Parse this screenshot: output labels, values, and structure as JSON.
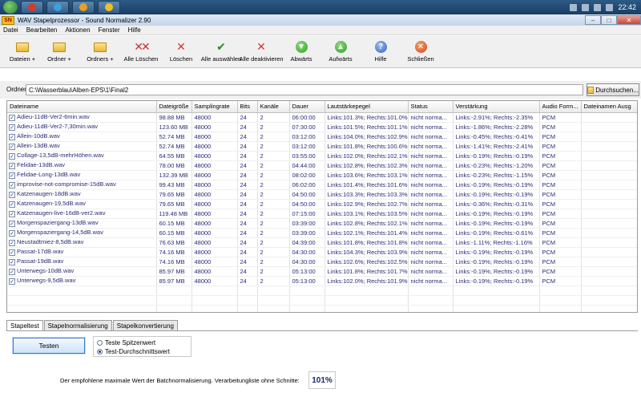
{
  "taskbar": {
    "clock": "22:42"
  },
  "window": {
    "title": "WAV Stapelprozessor - Sound Normalizer 2.90",
    "app_icon_text": "SN"
  },
  "menu": [
    "Datei",
    "Bearbeiten",
    "Aktionen",
    "Fenster",
    "Hilfe"
  ],
  "toolbar": [
    {
      "label": "Dateien +",
      "icon": "folder-icon"
    },
    {
      "label": "Ordner +",
      "icon": "folder-icon"
    },
    {
      "label": "Ordners +",
      "icon": "folder-icon"
    },
    {
      "label": "Alle Löschen",
      "icon": "double-x-icon"
    },
    {
      "label": "Löschen",
      "icon": "x-icon"
    },
    {
      "label": "Alle auswählen",
      "icon": "check-icon"
    },
    {
      "label": "Alle deaktivieren",
      "icon": "x-icon"
    },
    {
      "label": "Abwärts",
      "icon": "arrow-down-icon"
    },
    {
      "label": "Aufwärts",
      "icon": "arrow-up-icon"
    },
    {
      "label": "Hilfe",
      "icon": "help-icon"
    },
    {
      "label": "Schließen",
      "icon": "close-icon"
    }
  ],
  "folder": {
    "label": "Ordner",
    "value": "C:\\Wasserblau\\Alben-EPS\\1\\Final2",
    "browse_label": "Durchsuchen..."
  },
  "grid": {
    "columns": [
      "Dateiname",
      "Dateigröße",
      "Samplingrate",
      "Bits",
      "Kanäle",
      "Dauer",
      "Lautstärkepegel",
      "Status",
      "Verstärkung",
      "Audio Form...",
      "Dateinamen Ausg"
    ],
    "rows": [
      [
        "Adieu-11dB-Ver2-6min.wav",
        "98.88 MB",
        "48000",
        "24",
        "2",
        "06:00:00",
        "Links:101.3%; Rechts:101.0%",
        "nicht norma...",
        "Links:-2.91%; Rechts:-2.35%",
        "PCM",
        ""
      ],
      [
        "Adieu-11dB-Ver2-7,30min.wav",
        "123.60 MB",
        "48000",
        "24",
        "2",
        "07:30:00",
        "Links:101.5%; Rechts:101.1%",
        "nicht norma...",
        "Links:-1.86%; Rechts:-2.28%",
        "PCM",
        ""
      ],
      [
        "Allein-10dB.wav",
        "52.74 MB",
        "48000",
        "24",
        "2",
        "03:12:00",
        "Links:104.0%; Rechts:102.9%",
        "nicht norma...",
        "Links:-0.45%; Rechts:-0.41%",
        "PCM",
        ""
      ],
      [
        "Allein-13dB.wav",
        "52.74 MB",
        "48000",
        "24",
        "2",
        "03:12:00",
        "Links:101.8%; Rechts:100.6%",
        "nicht norma...",
        "Links:-1.41%; Rechts:-2.41%",
        "PCM",
        ""
      ],
      [
        "Collage-13,5dB-mehrHöhen.wav",
        "64.55 MB",
        "48000",
        "24",
        "2",
        "03:55:00",
        "Links:102.0%; Rechts:102.1%",
        "nicht norma...",
        "Links:-0.19%; Rechts:-0.19%",
        "PCM",
        ""
      ],
      [
        "Felidae-13dB.wav",
        "78.00 MB",
        "48000",
        "24",
        "2",
        "04:44:00",
        "Links:102.8%; Rechts:102.3%",
        "nicht norma...",
        "Links:-0.23%; Rechts:-1.20%",
        "PCM",
        ""
      ],
      [
        "Felidae-Long-13dB.wav",
        "132.39 MB",
        "48000",
        "24",
        "2",
        "08:02:00",
        "Links:103.6%; Rechts:103.1%",
        "nicht norma...",
        "Links:-0.23%; Rechts:-1.15%",
        "PCM",
        ""
      ],
      [
        "improvise-not-compromise-15dB.wav",
        "99.43 MB",
        "48000",
        "24",
        "2",
        "06:02:00",
        "Links:101.4%; Rechts:101.6%",
        "nicht norma...",
        "Links:-0.19%; Rechts:-0.19%",
        "PCM",
        ""
      ],
      [
        "Katzenaugen-18dB.wav",
        "79.65 MB",
        "48000",
        "24",
        "2",
        "04:50:00",
        "Links:103.3%; Rechts:103.3%",
        "nicht norma...",
        "Links:-0.19%; Rechts:-0.19%",
        "PCM",
        ""
      ],
      [
        "Katzenaugen-19,5dB.wav",
        "79.65 MB",
        "48000",
        "24",
        "2",
        "04:50:00",
        "Links:102.9%; Rechts:102.7%",
        "nicht norma...",
        "Links:-0.36%; Rechts:-0.31%",
        "PCM",
        ""
      ],
      [
        "Katzenaugen-live-16dB-ver2.wav",
        "119.48 MB",
        "48000",
        "24",
        "2",
        "07:15:00",
        "Links:103.1%; Rechts:103.5%",
        "nicht norma...",
        "Links:-0.19%; Rechts:-0.19%",
        "PCM",
        ""
      ],
      [
        "Morgenspaziergang-13dB.wav",
        "60.15 MB",
        "48000",
        "24",
        "2",
        "03:39:00",
        "Links:102.8%; Rechts:102.1%",
        "nicht norma...",
        "Links:-0.19%; Rechts:-0.19%",
        "PCM",
        ""
      ],
      [
        "Morgenspaziergang-14,5dB.wav",
        "60.15 MB",
        "48000",
        "24",
        "2",
        "03:39:00",
        "Links:102.1%; Rechts:101.4%",
        "nicht norma...",
        "Links:-0.19%; Rechts:-0.61%",
        "PCM",
        ""
      ],
      [
        "Neustadtmiez-8,5dB.wav",
        "76.63 MB",
        "48000",
        "24",
        "2",
        "04:39:00",
        "Links:101.8%; Rechts:101.8%",
        "nicht norma...",
        "Links:-1.11%; Rechts:-1.16%",
        "PCM",
        ""
      ],
      [
        "Passat-17dB.wav",
        "74.16 MB",
        "48000",
        "24",
        "2",
        "04:30:00",
        "Links:104.3%; Rechts:103.9%",
        "nicht norma...",
        "Links:-0.19%; Rechts:-0.19%",
        "PCM",
        ""
      ],
      [
        "Passat-19dB.wav",
        "74.16 MB",
        "48000",
        "24",
        "2",
        "04:30:00",
        "Links:102.6%; Rechts:102.5%",
        "nicht norma...",
        "Links:-0.19%; Rechts:-0.19%",
        "PCM",
        ""
      ],
      [
        "Unterwegs-10dB.wav",
        "85.97 MB",
        "48000",
        "24",
        "2",
        "05:13:00",
        "Links:101.8%; Rechts:101.7%",
        "nicht norma...",
        "Links:-0.19%; Rechts:-0.19%",
        "PCM",
        ""
      ],
      [
        "Unterwegs-9,5dB.wav",
        "85.97 MB",
        "48000",
        "24",
        "2",
        "05:13:00",
        "Links:102.0%; Rechts:101.9%",
        "nicht norma...",
        "Links:-0.19%; Rechts:-0.19%",
        "PCM",
        ""
      ]
    ]
  },
  "tabs": [
    "Stapeltest",
    "Stapelnormalisierung",
    "Stapelkonvertierung"
  ],
  "panel": {
    "test_button": "Testen",
    "radio_peak": "Teste Spitzenwert",
    "radio_avg": "Test-Durchschnittswert",
    "result_label": "Der empfohlene maximale Wert der Batchnormalisierung. Verarbeitungliste ohne Schnitte:",
    "result_value": "101%"
  }
}
